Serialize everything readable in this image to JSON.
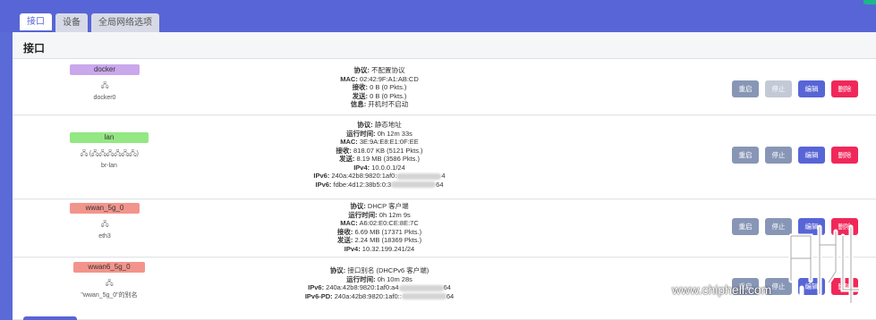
{
  "tabs": [
    "接口",
    "设备",
    "全局网络选项"
  ],
  "heading": "接口",
  "colors": {
    "accent": "#5865d6",
    "danger": "#f0285a",
    "neutral": "#8896b6"
  },
  "buttons": {
    "restart": "重启",
    "stop": "停止",
    "edit": "编辑",
    "delete": "删除"
  },
  "interfaces": [
    {
      "name": "docker",
      "badge_color": "#c9a8ec",
      "icon_text": "🖧",
      "device": "docker0",
      "lines": [
        {
          "k": "协议:",
          "v": " 不配置协议"
        },
        {
          "k": "MAC:",
          "v": " 02:42:9F:A1:AB:CD"
        },
        {
          "k": "接收:",
          "v": " 0 B (0 Pkts.)"
        },
        {
          "k": "发送:",
          "v": " 0 B (0 Pkts.)"
        },
        {
          "k": "信息:",
          "v": " 开机时不启动"
        }
      ]
    },
    {
      "name": "lan",
      "badge_color": "#93e883",
      "icon_text": "🖧 (🖧🖧🖧🖧🖧🖧)",
      "device": "br-lan",
      "lines": [
        {
          "k": "协议:",
          "v": " 静态地址"
        },
        {
          "k": "运行时间:",
          "v": " 0h 12m 33s"
        },
        {
          "k": "MAC:",
          "v": " 3E:9A:E8:E1:0F:EE"
        },
        {
          "k": "接收:",
          "v": " 818.07 KB (5121 Pkts.)"
        },
        {
          "k": "发送:",
          "v": " 8.19 MB (3586 Pkts.)"
        },
        {
          "k": "IPv4:",
          "v": " 10.0.0.1/24"
        },
        {
          "k": "IPv6:",
          "v": " 240a:42b8:9820:1af0:",
          "tail": "4"
        },
        {
          "k": "IPv6:",
          "v": " fdbe:4d12:38b5:0:3",
          "tail": "64"
        }
      ]
    },
    {
      "name": "wwan_5g_0",
      "badge_color": "#f2948c",
      "icon_text": "🖧",
      "device": "eth3",
      "lines": [
        {
          "k": "协议:",
          "v": " DHCP 客户端"
        },
        {
          "k": "运行时间:",
          "v": " 0h 12m 9s"
        },
        {
          "k": "MAC:",
          "v": " A6:02:E0:CE:8E:7C"
        },
        {
          "k": "接收:",
          "v": " 6.69 MB (17371 Pkts.)"
        },
        {
          "k": "发送:",
          "v": " 2.24 MB (18369 Pkts.)"
        },
        {
          "k": "IPv4:",
          "v": " 10.32.199.241/24"
        }
      ]
    },
    {
      "name": "wwan6_5g_0",
      "badge_color": "#f2948c",
      "icon_text": "🖧",
      "device": "\"wwan_5g_0\"的别名",
      "lines": [
        {
          "k": "协议:",
          "v": " 接口别名 (DHCPv6 客户端)"
        },
        {
          "k": "运行时间:",
          "v": " 0h 10m 28s"
        },
        {
          "k": "IPv6:",
          "v": " 240a:42b8:9820:1af0:a4",
          "tail": "64"
        },
        {
          "k": "IPv6-PD:",
          "v": " 240a:42b8:9820:1af0::",
          "tail": "64"
        }
      ]
    }
  ],
  "watermark": "www.chiphell.com"
}
